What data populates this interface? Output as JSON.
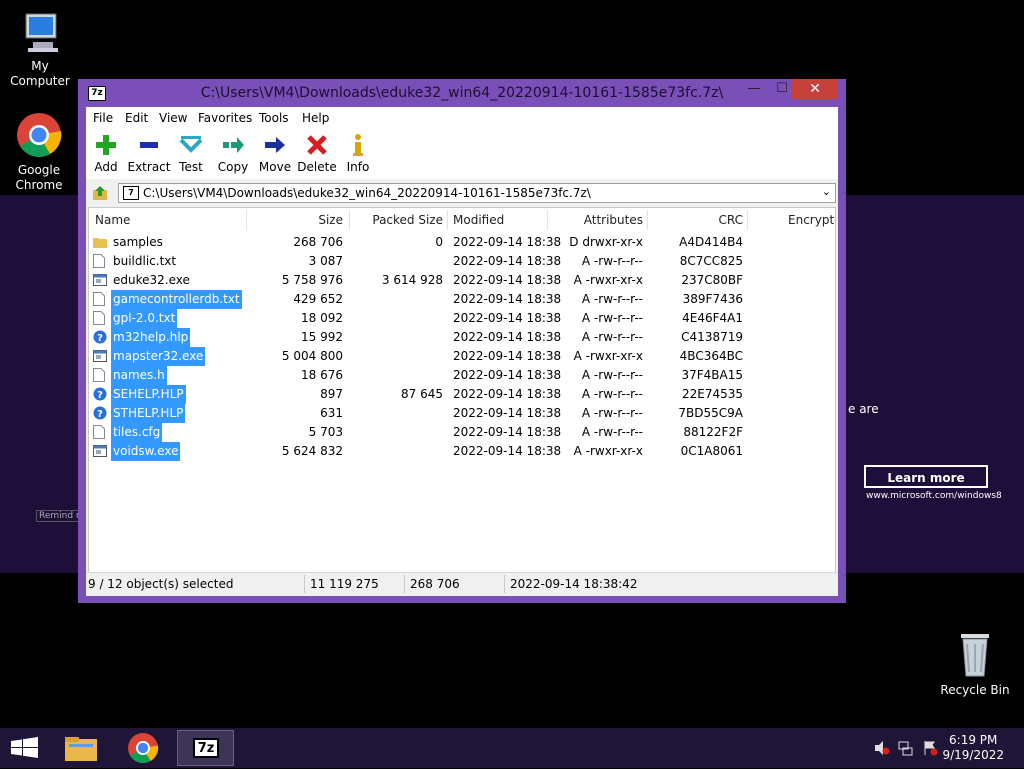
{
  "desktop": {
    "icons": [
      {
        "label": "My Computer",
        "icon": "computer-icon"
      },
      {
        "label": "Google Chrome",
        "icon": "chrome-icon"
      },
      {
        "label": "Recycle Bin",
        "icon": "recycle-bin-icon"
      }
    ],
    "background": {
      "side_text": "e are",
      "learn_more": "Learn more",
      "ms_url": "www.microsoft.com/windows8",
      "remind": "Remind m"
    }
  },
  "window": {
    "title": "C:\\Users\\VM4\\Downloads\\eduke32_win64_20220914-10161-1585e73fc.7z\\",
    "app_icon_text": "7z",
    "controls": {
      "minimize": "—",
      "maximize": "☐",
      "close": "✕"
    },
    "menu": [
      "File",
      "Edit",
      "View",
      "Favorites",
      "Tools",
      "Help"
    ],
    "toolbar": [
      {
        "label": "Add",
        "icon": "plus-icon"
      },
      {
        "label": "Extract",
        "icon": "minus-icon"
      },
      {
        "label": "Test",
        "icon": "check-icon"
      },
      {
        "label": "Copy",
        "icon": "copy-arrow-icon"
      },
      {
        "label": "Move",
        "icon": "move-arrow-icon"
      },
      {
        "label": "Delete",
        "icon": "delete-x-icon"
      },
      {
        "label": "Info",
        "icon": "info-icon"
      }
    ],
    "address": "C:\\Users\\VM4\\Downloads\\eduke32_win64_20220914-10161-1585e73fc.7z\\",
    "columns": [
      "Name",
      "Size",
      "Packed Size",
      "Modified",
      "Attributes",
      "CRC",
      "Encrypte"
    ],
    "files": [
      {
        "name": "samples",
        "size": "268 706",
        "packed": "0",
        "modified": "2022-09-14 18:38",
        "attr": "D drwxr-xr-x",
        "crc": "A4D414B4",
        "type": "folder",
        "selected": false
      },
      {
        "name": "buildlic.txt",
        "size": "3 087",
        "packed": "",
        "modified": "2022-09-14 18:38",
        "attr": "A -rw-r--r--",
        "crc": "8C7CC825",
        "type": "text",
        "selected": false
      },
      {
        "name": "eduke32.exe",
        "size": "5 758 976",
        "packed": "3 614 928",
        "modified": "2022-09-14 18:38",
        "attr": "A -rwxr-xr-x",
        "crc": "237C80BF",
        "type": "exe",
        "selected": false
      },
      {
        "name": "gamecontrollerdb.txt",
        "size": "429 652",
        "packed": "",
        "modified": "2022-09-14 18:38",
        "attr": "A -rw-r--r--",
        "crc": "389F7436",
        "type": "text",
        "selected": true
      },
      {
        "name": "gpl-2.0.txt",
        "size": "18 092",
        "packed": "",
        "modified": "2022-09-14 18:38",
        "attr": "A -rw-r--r--",
        "crc": "4E46F4A1",
        "type": "text",
        "selected": true
      },
      {
        "name": "m32help.hlp",
        "size": "15 992",
        "packed": "",
        "modified": "2022-09-14 18:38",
        "attr": "A -rw-r--r--",
        "crc": "C4138719",
        "type": "help",
        "selected": true
      },
      {
        "name": "mapster32.exe",
        "size": "5 004 800",
        "packed": "",
        "modified": "2022-09-14 18:38",
        "attr": "A -rwxr-xr-x",
        "crc": "4BC364BC",
        "type": "exe",
        "selected": true
      },
      {
        "name": "names.h",
        "size": "18 676",
        "packed": "",
        "modified": "2022-09-14 18:38",
        "attr": "A -rw-r--r--",
        "crc": "37F4BA15",
        "type": "text",
        "selected": true
      },
      {
        "name": "SEHELP.HLP",
        "size": "897",
        "packed": "87 645",
        "modified": "2022-09-14 18:38",
        "attr": "A -rw-r--r--",
        "crc": "22E74535",
        "type": "help",
        "selected": true
      },
      {
        "name": "STHELP.HLP",
        "size": "631",
        "packed": "",
        "modified": "2022-09-14 18:38",
        "attr": "A -rw-r--r--",
        "crc": "7BD55C9A",
        "type": "help",
        "selected": true
      },
      {
        "name": "tiles.cfg",
        "size": "5 703",
        "packed": "",
        "modified": "2022-09-14 18:38",
        "attr": "A -rw-r--r--",
        "crc": "88122F2F",
        "type": "text",
        "selected": true
      },
      {
        "name": "voidsw.exe",
        "size": "5 624 832",
        "packed": "",
        "modified": "2022-09-14 18:38",
        "attr": "A -rwxr-xr-x",
        "crc": "0C1A8061",
        "type": "exe",
        "selected": true
      }
    ],
    "status": {
      "selected": "9 / 12 object(s) selected",
      "size": "11 119 275",
      "packed": "268 706",
      "modified": "2022-09-14 18:38:42"
    }
  },
  "taskbar": {
    "items": [
      {
        "icon": "windows-start-icon"
      },
      {
        "icon": "file-explorer-icon"
      },
      {
        "icon": "chrome-icon"
      },
      {
        "icon": "7zip-icon",
        "text": "7z"
      }
    ],
    "tray": {
      "time": "6:19 PM",
      "date": "9/19/2022"
    }
  }
}
